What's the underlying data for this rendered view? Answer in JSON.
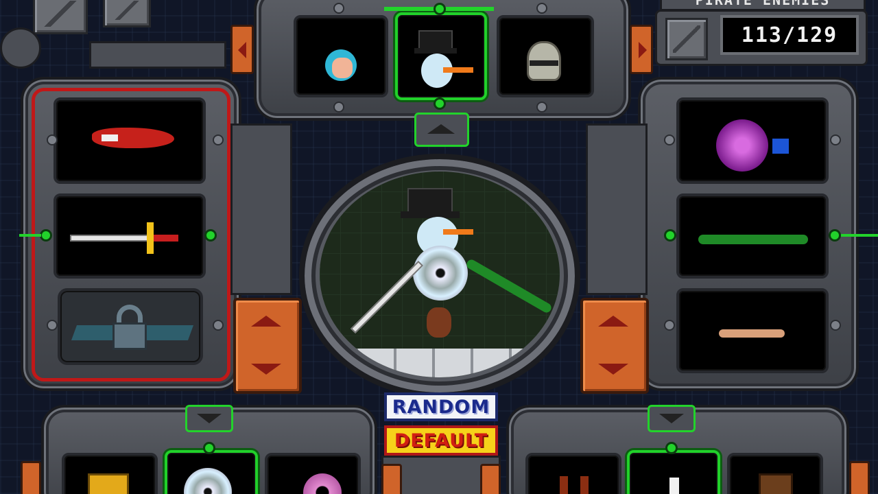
{
  "header": {
    "title": "PIRATE ENEMIES",
    "counter": "113/129"
  },
  "buttons": {
    "random": "RANDOM",
    "default": "DEFAULT"
  },
  "colors": {
    "selected": "#22d32b",
    "orange_panel": "#d0642a",
    "locked_frame": "#c01818",
    "random_text": "#1a2a8c",
    "default_bg": "#f6d21a",
    "default_text": "#d11f12"
  },
  "slots": {
    "head": [
      "mermaid-head",
      "snowman-head",
      "knight-helmet-head"
    ],
    "left": [
      "red-claw-arm",
      "golden-sword",
      "stealth-jet-locked"
    ],
    "right": [
      "purple-urchin-ball",
      "green-snake-arm",
      "bare-arm"
    ],
    "bottom_left": [
      "golden-trophy",
      "compact-disc",
      "pink-donut"
    ],
    "bottom_right": [
      "bottles",
      "meat-drumstick",
      "wooden-crate"
    ]
  },
  "locked": {
    "left_slot_3": true
  }
}
